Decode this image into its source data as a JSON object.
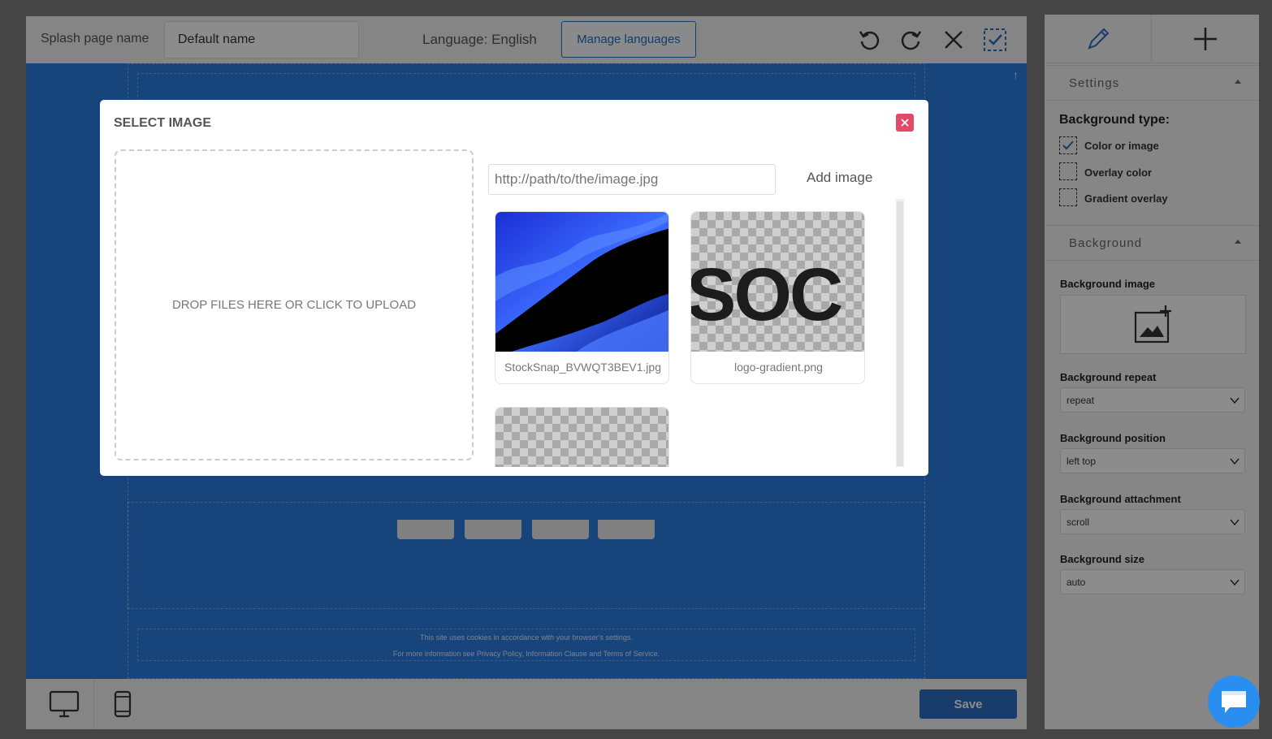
{
  "topbar": {
    "name_label": "Splash page name",
    "name_value": "Default name",
    "language_label": "Language: English",
    "manage_label": "Manage languages"
  },
  "canvas": {
    "cookie_line1": "This site uses cookies in accordance with your browser's settings.",
    "cookie_line2": "For more information see Privacy Policy, Information Clause and Terms of Service."
  },
  "bottombar": {
    "save_label": "Save"
  },
  "panel": {
    "settings_label": "Settings",
    "background_type_label": "Background type:",
    "bg_types": [
      {
        "label": "Color or image",
        "checked": true
      },
      {
        "label": "Overlay color",
        "checked": false
      },
      {
        "label": "Gradient overlay",
        "checked": false
      }
    ],
    "background_section_label": "Background",
    "background_image_label": "Background image",
    "repeat_label": "Background repeat",
    "repeat_value": "repeat",
    "position_label": "Background position",
    "position_value": "left top",
    "attachment_label": "Background attachment",
    "attachment_value": "scroll",
    "size_label": "Background size",
    "size_value": "auto"
  },
  "modal": {
    "title": "SELECT IMAGE",
    "dropzone_text": "DROP FILES HERE OR CLICK TO UPLOAD",
    "url_placeholder": "http://path/to/the/image.jpg",
    "add_image_label": "Add image",
    "images": [
      {
        "caption": "StockSnap_BVWQT3BEV1.jpg"
      },
      {
        "caption": "logo-gradient.png",
        "logo_text": "SOC"
      },
      {
        "caption": ""
      }
    ]
  },
  "colors": {
    "accent": "#2a6ebf",
    "canvas_blue": "#2a7de1",
    "close_red": "#e24a6c",
    "chat_blue": "#2a8ef0"
  }
}
